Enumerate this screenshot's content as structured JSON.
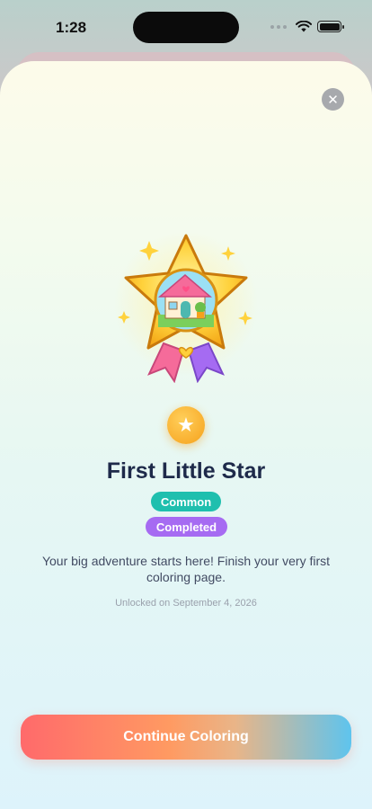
{
  "status_bar": {
    "time": "1:28"
  },
  "icons": {
    "close": "close-icon",
    "star": "star-icon",
    "badge": "house-star-badge-icon",
    "wifi": "wifi-icon",
    "battery": "battery-icon",
    "signal": "signal-dots-icon"
  },
  "achievement": {
    "title": "First Little Star",
    "rarity": "Common",
    "status": "Completed",
    "description": "Your big adventure starts here! Finish your very first coloring page.",
    "unlocked_text": "Unlocked on September 4, 2026"
  },
  "actions": {
    "close_symbol": "✕",
    "continue_label": "Continue Coloring"
  },
  "colors": {
    "rarity": "#1fbfae",
    "status": "#a66bf2",
    "title": "#1e2a4a",
    "cta_start": "#ff6a6b",
    "cta_end": "#5ec4ee"
  }
}
